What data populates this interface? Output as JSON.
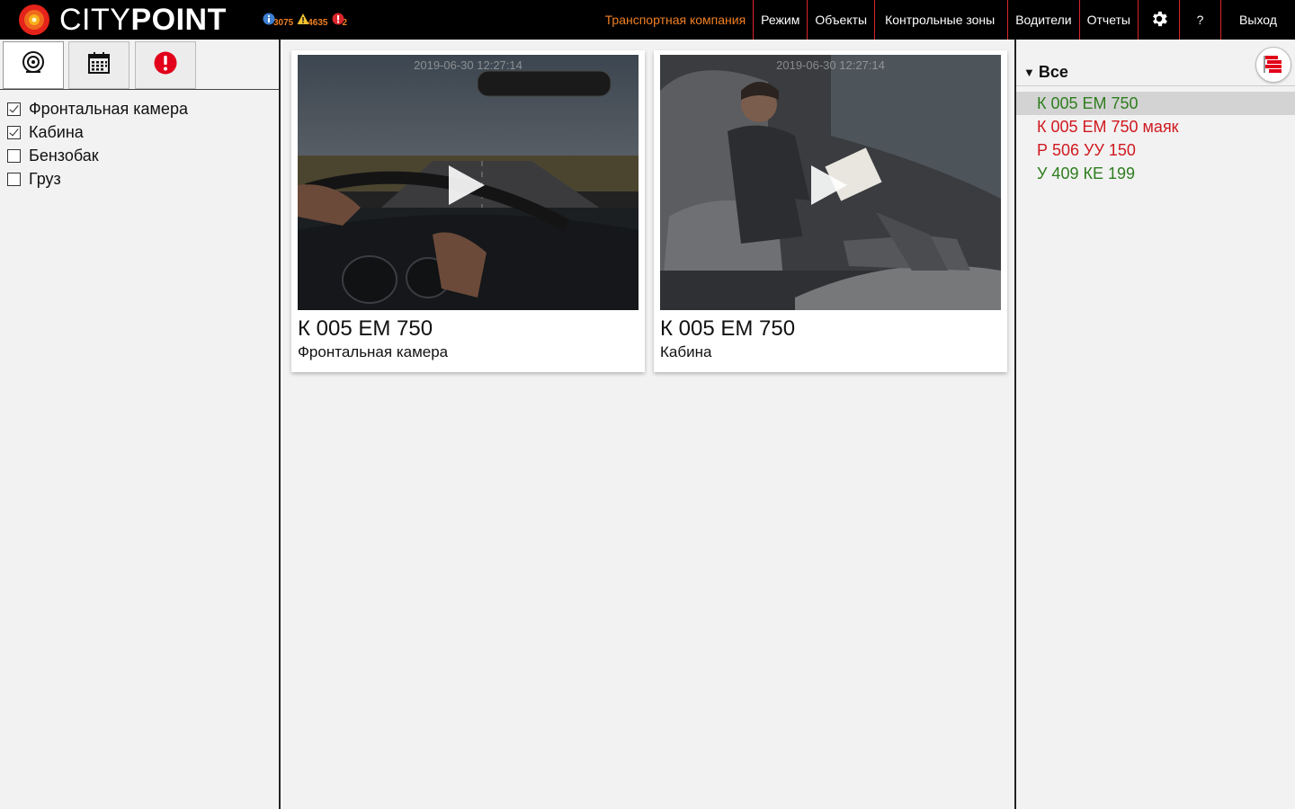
{
  "app": {
    "logo_text_light": "CITY",
    "logo_text_bold": "POINT"
  },
  "counters": [
    {
      "icon": "info-icon",
      "value": "3075"
    },
    {
      "icon": "warning-icon",
      "value": "4635"
    },
    {
      "icon": "alert-icon",
      "value": "2"
    }
  ],
  "nav": {
    "items": [
      {
        "label": "Транспортная компания",
        "active": true
      },
      {
        "label": "Режим"
      },
      {
        "label": "Объекты"
      },
      {
        "label": "Контрольные зоны"
      },
      {
        "label": "Водители"
      },
      {
        "label": "Отчеты"
      }
    ],
    "settings_icon": "gear-icon",
    "help_label": "?",
    "exit_label": "Выход"
  },
  "left_panel": {
    "tabs": [
      {
        "icon": "camera-icon",
        "active": true
      },
      {
        "icon": "calendar-icon"
      },
      {
        "icon": "alert-icon"
      }
    ],
    "filters": [
      {
        "label": "Фронтальная камера",
        "checked": true
      },
      {
        "label": "Кабина",
        "checked": true
      },
      {
        "label": "Бензобак",
        "checked": false
      },
      {
        "label": "Груз",
        "checked": false
      }
    ]
  },
  "videos": [
    {
      "timestamp": "2019-06-30 12:27:14",
      "plate": "К 005 ЕМ 750",
      "camera": "Фронтальная камера"
    },
    {
      "timestamp": "2019-06-30 12:27:14",
      "plate": "К 005 ЕМ 750",
      "camera": "Кабина"
    }
  ],
  "right_panel": {
    "group_label": "Все",
    "layers_icon": "layers-icon",
    "vehicles": [
      {
        "label": "К 005 ЕМ 750",
        "color": "#2e7d1e",
        "selected": true
      },
      {
        "label": "К 005 ЕМ 750 маяк",
        "color": "#d0191f"
      },
      {
        "label": "Р 506 УУ 150",
        "color": "#d0191f"
      },
      {
        "label": "У 409 КЕ 199",
        "color": "#2e7d1e"
      }
    ]
  },
  "colors": {
    "accent": "#f07f22",
    "brand_red": "#d9252b",
    "ok_green": "#2e7d1e"
  }
}
